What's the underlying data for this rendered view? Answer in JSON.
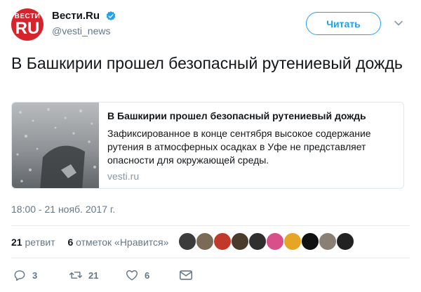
{
  "author": {
    "logo_top": "ВЕСТИ",
    "logo_main": "RU",
    "display_name": "Вести.Ru",
    "handle": "@vesti_news",
    "verified": true,
    "brand_color": "#d6242c"
  },
  "follow_button": {
    "label": "Читать"
  },
  "tweet": {
    "text": "В Башкирии прошел безопасный рутениевый дождь"
  },
  "card": {
    "title": "В Башкирии прошел безопасный рутениевый дождь",
    "description": "Зафиксированное в конце сентября высокое содержание рутения в атмосферных осадках в Уфе не представляет опасности для окружающей среды.",
    "domain": "vesti.ru"
  },
  "timestamp": "18:00 - 21 нояб. 2017 г.",
  "stats": {
    "retweets_count": "21",
    "retweets_label": "ретвит",
    "likes_count": "6",
    "likes_label": "отметок «Нравится»"
  },
  "liker_avatars": [
    "#3b3b3b",
    "#7b6a55",
    "#c0392b",
    "#4a3b2c",
    "#2f2f2f",
    "#d94f8a",
    "#e6a524",
    "#111111",
    "#8a7f74",
    "#222222"
  ],
  "actions": {
    "reply_count": "3",
    "retweet_count": "21",
    "like_count": "6"
  },
  "colors": {
    "accent": "#1da1f2",
    "secondary_text": "#657786"
  }
}
